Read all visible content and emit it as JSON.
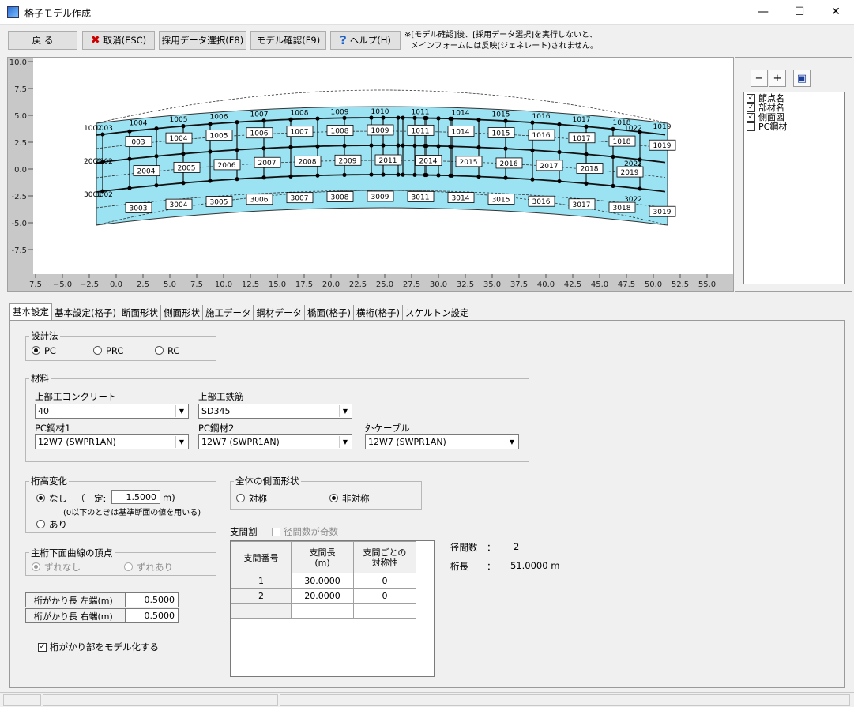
{
  "window": {
    "title": "格子モデル作成",
    "minimize": "—",
    "maximize": "☐",
    "close": "✕"
  },
  "toolbar": {
    "back": "戻 る",
    "cancel": "取消(ESC)",
    "select_data": "採用データ選択(F8)",
    "model_check": "モデル確認(F9)",
    "help": "ヘルプ(H)",
    "note_line1": "※[モデル確認]後、[採用データ選択]を実行しないと、",
    "note_line2": "メインフォームには反映(ジェネレート)されません。"
  },
  "plot": {
    "y_ticks": [
      "10.0",
      "7.5",
      "5.0",
      "2.5",
      "0.0",
      "-2.5",
      "-5.0",
      "-7.5"
    ],
    "x_ticks": [
      "7.5",
      "−5.0",
      "−2.5",
      "0.0",
      "2.5",
      "5.0",
      "7.5",
      "10.0",
      "12.5",
      "15.0",
      "17.5",
      "20.0",
      "22.5",
      "25.0",
      "27.5",
      "30.0",
      "32.5",
      "35.0",
      "37.5",
      "40.0",
      "42.5",
      "45.0",
      "47.5",
      "50.0",
      "52.5",
      "55.0"
    ],
    "row1000": [
      "1004",
      "1005",
      "1006",
      "1007",
      "1008",
      "1009",
      "1010",
      "1011",
      "1014",
      "1015",
      "1016",
      "1017",
      "1018",
      "1019"
    ],
    "row1000_box": [
      "003",
      "1004",
      "1005",
      "1006",
      "1007",
      "1008",
      "1009",
      "1011",
      "1014",
      "1015",
      "1016",
      "1017",
      "1018",
      "1019"
    ],
    "row2000": [
      "2004",
      "2005",
      "2006",
      "2007",
      "2008",
      "2009",
      "2011",
      "2014",
      "2015",
      "2016",
      "2017",
      "2018",
      "2019"
    ],
    "row3000_box": [
      "3003",
      "3004",
      "3005",
      "3006",
      "3007",
      "3008",
      "3009",
      "3011",
      "3014",
      "3015",
      "3016",
      "3017",
      "3018",
      "3019"
    ],
    "left_labels": [
      "1002",
      "1003",
      "2001",
      "2002",
      "3001",
      "3002"
    ],
    "right_labels": [
      "1022",
      "2022",
      "3022"
    ]
  },
  "side": {
    "zoom_out": "−",
    "zoom_in": "+",
    "fit": "▣",
    "items": [
      {
        "label": "節点名",
        "checked": true
      },
      {
        "label": "部材名",
        "checked": true
      },
      {
        "label": "側面図",
        "checked": true
      },
      {
        "label": "PC鋼材",
        "checked": false
      }
    ]
  },
  "tabs": [
    "基本設定",
    "基本設定(格子)",
    "断面形状",
    "側面形状",
    "施工データ",
    "鋼材データ",
    "橋面(格子)",
    "横桁(格子)",
    "スケルトン設定"
  ],
  "design": {
    "title": "設計法",
    "options": [
      "PC",
      "PRC",
      "RC"
    ],
    "selected": "PC"
  },
  "material": {
    "title": "材料",
    "concrete_label": "上部工コンクリート",
    "concrete_value": "40",
    "rebar_label": "上部工鉄筋",
    "rebar_value": "SD345",
    "pc1_label": "PC鋼材1",
    "pc1_value": "12W7 (SWPR1AN)",
    "pc2_label": "PC鋼材2",
    "pc2_value": "12W7 (SWPR1AN)",
    "ext_label": "外ケーブル",
    "ext_value": "12W7 (SWPR1AN)"
  },
  "height": {
    "title": "桁高変化",
    "none": "なし",
    "const_label": "（一定:",
    "const_value": "1.5000",
    "unit": "m)",
    "hint": "(0以下のときは基準断面の値を用いる)",
    "exist": "あり"
  },
  "bottom": {
    "title": "主桁下面曲線の頂点",
    "opt1": "ずれなし",
    "opt2": "ずれあり"
  },
  "overhang": {
    "left_label": "桁がかり長  左端(m)",
    "left_value": "0.5000",
    "right_label": "桁がかり長  右端(m)",
    "right_value": "0.5000",
    "model_label": "桁がかり部をモデル化する",
    "model_checked": "✓"
  },
  "side_shape": {
    "title": "全体の側面形状",
    "sym": "対称",
    "asym": "非対称"
  },
  "span": {
    "title": "支間割",
    "odd_label": "径間数が奇数",
    "headers": [
      "支間番号",
      "支間長\n(m)",
      "支間ごとの\n対称性"
    ],
    "rows": [
      [
        "1",
        "30.0000",
        "0"
      ],
      [
        "2",
        "20.0000",
        "0"
      ]
    ],
    "count_label": "径間数　：",
    "count_value": "2",
    "length_label": "桁長　　：",
    "length_value": "51.0000 m"
  }
}
